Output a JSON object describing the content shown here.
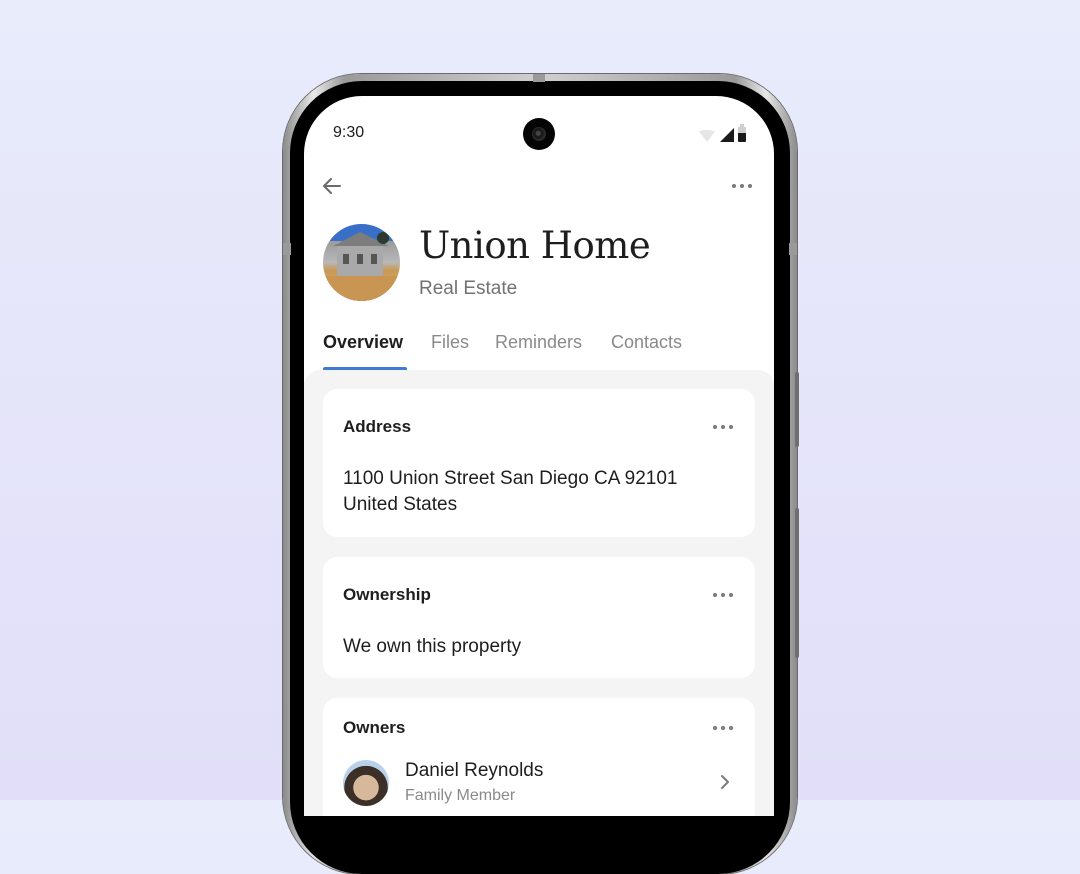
{
  "status_bar": {
    "time": "9:30",
    "icons": [
      "wifi-icon",
      "signal-icon",
      "battery-icon"
    ]
  },
  "top_nav": {
    "back_icon": "arrow-left-icon",
    "more_icon": "more-horizontal-icon"
  },
  "header": {
    "title": "Union Home",
    "subtitle": "Real Estate",
    "avatar": "house-photo"
  },
  "tabs": [
    {
      "label": "Overview",
      "active": true
    },
    {
      "label": "Files",
      "active": false
    },
    {
      "label": "Reminders",
      "active": false
    },
    {
      "label": "Contacts",
      "active": false
    }
  ],
  "accent_color": "#3f7ad4",
  "cards": {
    "address": {
      "title": "Address",
      "line1": "1100 Union Street San Diego CA 92101",
      "line2": "United States"
    },
    "ownership": {
      "title": "Ownership",
      "value": "We own this property"
    },
    "owners": {
      "title": "Owners",
      "items": [
        {
          "name": "Daniel Reynolds",
          "role": "Family Member"
        }
      ]
    }
  }
}
